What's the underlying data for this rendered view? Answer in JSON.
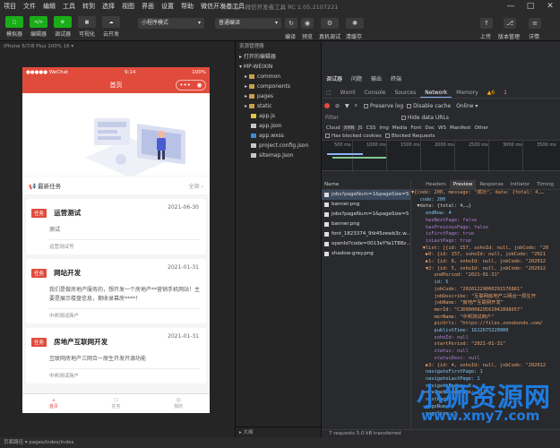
{
  "menu": [
    "项目",
    "文件",
    "编辑",
    "工具",
    "转到",
    "选择",
    "视图",
    "界面",
    "设置",
    "帮助",
    "微信开发者工具"
  ],
  "window_title": "未命名 - 微信开发者工具 RC 1.05.2107221",
  "toolbar": {
    "left": [
      {
        "label": "模拟器",
        "btn": "□"
      },
      {
        "label": "编辑器",
        "btn": "</>"
      },
      {
        "label": "调试器",
        "btn": "⚙"
      },
      {
        "label": "可视化",
        "btn": "▦"
      },
      {
        "label": "云开发",
        "btn": "☁"
      }
    ],
    "mode_select": "小程序模式",
    "compile_select": "普通编译",
    "compile_labels": [
      "编译",
      "预览",
      "真机调试",
      "清缓存"
    ],
    "right": [
      "上传",
      "版本管理",
      "详情"
    ]
  },
  "simulator": {
    "device_label": "iPhone 6/7/8 Plus 100% 16 ▾",
    "status_carrier": "●●●●● WeChat",
    "status_time": "9:14",
    "status_battery": "100%",
    "nav_title": "首页",
    "task_header": "最新任务",
    "task_all": "全部",
    "cards": [
      {
        "tag": "任务",
        "title": "运营测试",
        "date": "2021-06-30",
        "desc": "测试",
        "shop": "运营测试号"
      },
      {
        "tag": "任务",
        "title": "网站开发",
        "date": "2021-01-31",
        "desc": "我们是做房地产服务的，想开发一个房地产**营销手机网站！主要是展示楼盘信息，期收录幕房****！",
        "shop": "中邦测试商户"
      },
      {
        "tag": "任务",
        "title": "房地产互联网开发",
        "date": "2021-01-31",
        "desc": "互联网房地产三网合一原生开发开源功能",
        "shop": "中邦测试商户"
      }
    ],
    "tabs": [
      "首页",
      "任务",
      "我的"
    ]
  },
  "explorer": {
    "title": "资源管理器",
    "open_editors": "打开的编辑器",
    "project": "MP-WEIXIN",
    "items": [
      {
        "name": "common",
        "type": "folder"
      },
      {
        "name": "components",
        "type": "folder"
      },
      {
        "name": "pages",
        "type": "folder"
      },
      {
        "name": "static",
        "type": "folder"
      },
      {
        "name": "app.js",
        "type": "js"
      },
      {
        "name": "app.json",
        "type": "json"
      },
      {
        "name": "app.wxss",
        "type": "wxss"
      },
      {
        "name": "project.config.json",
        "type": "json"
      },
      {
        "name": "sitemap.json",
        "type": "json"
      }
    ],
    "outline": "大纲"
  },
  "devtools": {
    "top_tabs": [
      "调试器",
      "问题",
      "输出",
      "终端"
    ],
    "panel_tabs": [
      "Wxml",
      "Console",
      "Sources",
      "Network",
      "Memory"
    ],
    "active_panel": "Network",
    "warnings": "▲6",
    "errors": "1",
    "options": {
      "preserve": "Preserve log",
      "disable_cache": "Disable cache",
      "online": "Online"
    },
    "filter_label": "Filter",
    "hide_urls": "Hide data URLs",
    "types": [
      "Cloud",
      "XHR",
      "JS",
      "CSS",
      "Img",
      "Media",
      "Font",
      "Doc",
      "WS",
      "Manifest",
      "Other"
    ],
    "blocked": [
      "Has blocked cookies",
      "Blocked Requests"
    ],
    "ticks": [
      "500 ms",
      "1000 ms",
      "1500 ms",
      "2000 ms",
      "2500 ms",
      "3000 ms",
      "3500 ms"
    ],
    "name_header": "Name",
    "requests": [
      "jobs?pageNum=1&pageSize=5",
      "banner.png",
      "jobs?pageNum=1&pageSize=5",
      "banner.png",
      "font_1823374_9tk45zewb3c.w...",
      "openId?code=0013eYYa1T88z...",
      "shadow-grey.png"
    ],
    "preview_tabs": [
      "Headers",
      "Preview",
      "Response",
      "Initiator",
      "Timing"
    ],
    "active_preview": "Preview",
    "status_line": "7 requests    5.0 kB transferred"
  },
  "json_preview": [
    "▼{code: 200, message: \"成功\", data: {total: 4,…",
    "   code: 200",
    "  ▼data: {total: 4,…}",
    "     endRow: 4",
    "     hasNextPage: false",
    "     hasPreviousPage: false",
    "     isFirstPage: true",
    "     isLastPage: true",
    "    ▼list: [{id: 157, sohoId: null, jobCode: \"20",
    "     ▶0: {id: 157, sohoId: null, jobCode: \"2021",
    "     ▶1: {id: 8, sohoId: null, jobCode: \"202012",
    "     ▼2: {id: 5, sohoId: null, jobCode: \"202012",
    "        endPeriod: \"2021-01-31\"",
    "        id: 5",
    "        jobCode: \"20201229000291576881\"",
    "        jobDescribe: \"互联网房地产三网合一原生开",
    "        jobName: \"房地产互联网开发\"",
    "        merId: \"CJD0000829561042898657\"",
    "        merName: \"中邦测试商户\"",
    "        picUrls: \"https://files.zonebonds.com/",
    "        publishTime: 1612675320000",
    "        sohoId: null",
    "        startPeriod: \"2021-01-31\"",
    "        status: null",
    "        statusDesc: null",
    "     ▶3: {id: 4, sohoId: null, jobCode: \"202012",
    "     navigateFirstPage: 1",
    "     navigateLastPage: 1",
    "     navigatePages: 8",
    "    ▶navigatepageNums: [1]",
    "     nextPage: 0",
    "     pageNum: 1",
    "     pageSize: 5"
  ],
  "footer": "页面路径 ▾   pages/index/index",
  "watermark": "小狮资源网",
  "watermark_url": "www.xmy7.com"
}
